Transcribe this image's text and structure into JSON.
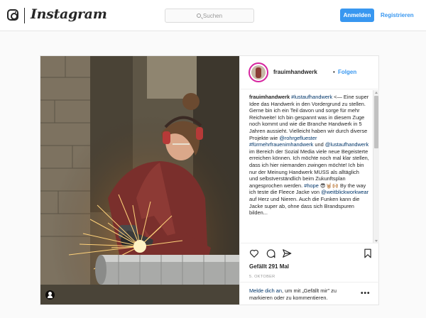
{
  "header": {
    "wordmark": "Instagram",
    "search_placeholder": "Suchen",
    "login_label": "Anmelden",
    "register_label": "Registrieren",
    "accent_color": "#3897f0"
  },
  "post": {
    "username": "frauimhandwerk",
    "follow_separator": "•",
    "follow_label": "Folgen",
    "caption": {
      "user": "frauimhandwerk",
      "t1": " ",
      "tag1": "#lustaufhandwerk",
      "t2": " <— Eine super Idee das Handwerk in den Vordergrund zu stellen. Gerne bin ich ein Teil davon und sorge für mehr Reichweite! Ich bin gespannt was in diesem Zuge noch kommt und wie die Branche Handwerk in 5 Jahren aussieht. Vielleicht haben wir durch diverse Projekte wie ",
      "tag2": "@rohrgefluester",
      "t3": " ",
      "tag3": "#fürmehrfrauenimhandwerk",
      "t4": " und ",
      "tag4": "@lustaufhandwerk",
      "t5": " im Bereich der Sozial Media viele neue Begeisterte erreichen können. Ich möchte noch mal klar stellen, dass ich hier niemanden zwingen möchte! Ich bin nur der Meinung Handwerk MUSS als alltäglich und selbstverständlich beim Zukunftsplan angesprochen werden. ",
      "tag5": "#hope",
      "t6": " 😎🤘🏼🙌🏼 By the way ich teste die Fleece Jacke von ",
      "tag6": "@weitblickworkwear",
      "t7": " auf Herz und Nieren. Auch die Funken kann die Jacke super ab, ohne dass sich Brandspuren bilden..."
    },
    "likes": "Gefällt 291 Mal",
    "date": "5. OKTOBER",
    "login_link": "Melde dich an",
    "login_text": ", um mit „Gefällt mir\" zu markieren oder zu kommentieren.",
    "more_label": "•••",
    "icons": [
      "instagram-logo-icon",
      "search-icon",
      "user-tag-icon",
      "heart-icon",
      "comment-icon",
      "share-icon",
      "bookmark-icon",
      "more-icon"
    ]
  }
}
